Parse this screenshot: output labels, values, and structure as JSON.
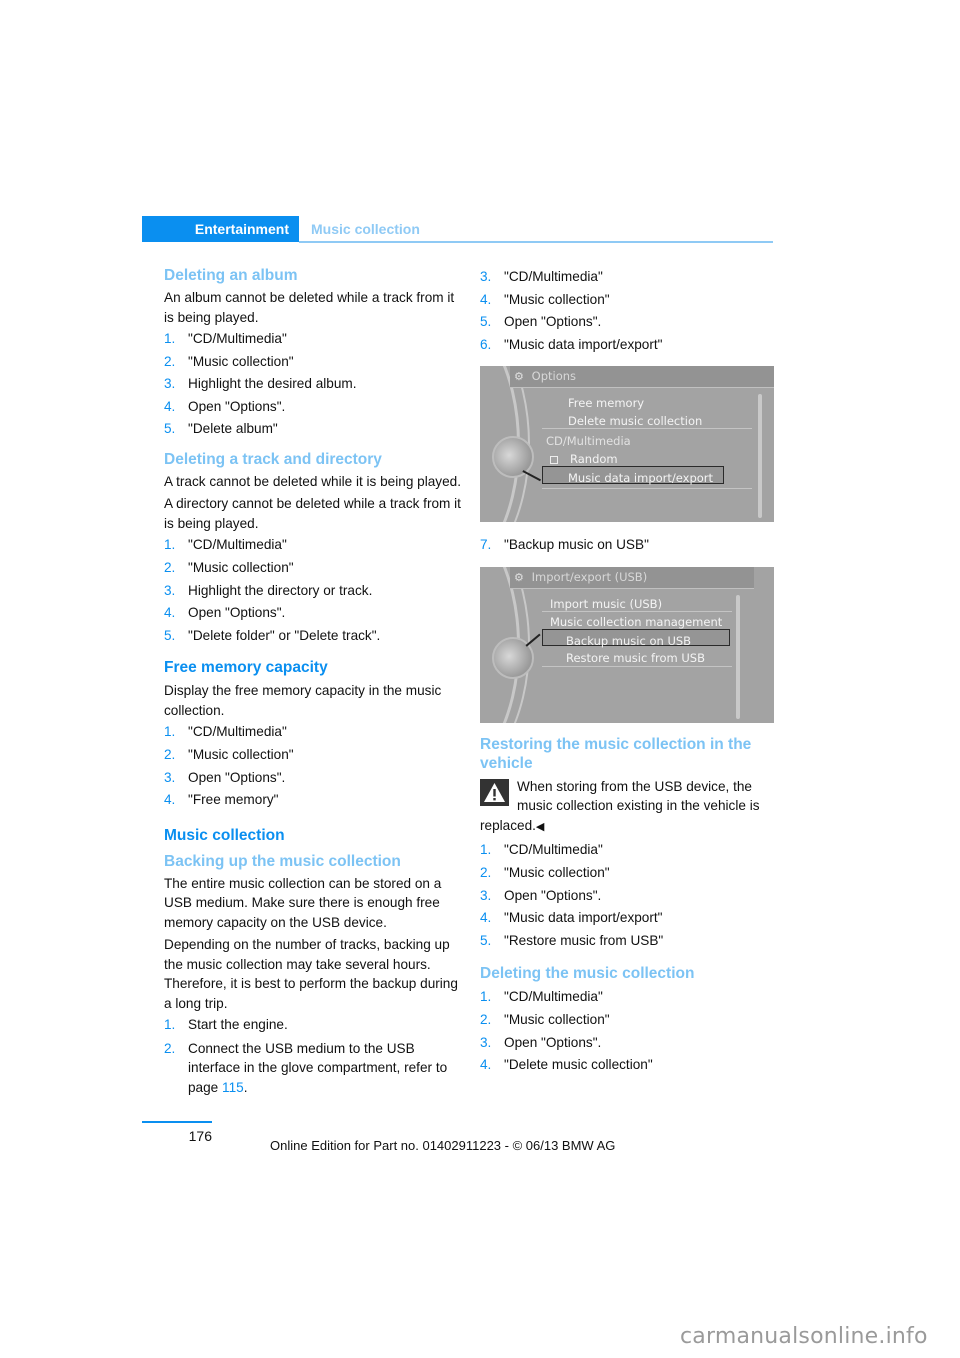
{
  "header": {
    "chapter": "Entertainment",
    "section": "Music collection"
  },
  "left_column": {
    "deleting_album": {
      "heading": "Deleting an album",
      "intro": "An album cannot be deleted while a track from it is being played.",
      "steps": [
        "\"CD/Multimedia\"",
        "\"Music collection\"",
        "Highlight the desired album.",
        "Open \"Options\".",
        "\"Delete album\""
      ]
    },
    "deleting_track": {
      "heading": "Deleting a track and directory",
      "intro1": "A track cannot be deleted while it is being played.",
      "intro2": "A directory cannot be deleted while a track from it is being played.",
      "steps": [
        "\"CD/Multimedia\"",
        "\"Music collection\"",
        "Highlight the directory or track.",
        "Open \"Options\".",
        "\"Delete folder\" or \"Delete track\"."
      ]
    },
    "free_memory": {
      "heading": "Free memory capacity",
      "intro": "Display the free memory capacity in the music collection.",
      "steps": [
        "\"CD/Multimedia\"",
        "\"Music collection\"",
        "Open \"Options\".",
        "\"Free memory\""
      ]
    },
    "music_collection": {
      "heading": "Music collection"
    },
    "backing_up": {
      "heading": "Backing up the music collection",
      "intro1": "The entire music collection can be stored on a USB medium. Make sure there is enough free memory capacity on the USB device.",
      "intro2": "Depending on the number of tracks, backing up the music collection may take several hours. Therefore, it is best to perform the backup during a long trip.",
      "step1": "Start the engine.",
      "step2_text": "Connect the USB medium to the USB interface in the glove compartment, refer to page ",
      "step2_link": "115",
      "step2_end": "."
    }
  },
  "right_column": {
    "continued_steps": [
      {
        "num": "3.",
        "text": "\"CD/Multimedia\""
      },
      {
        "num": "4.",
        "text": "\"Music collection\""
      },
      {
        "num": "5.",
        "text": "Open \"Options\"."
      },
      {
        "num": "6.",
        "text": "\"Music data import/export\""
      }
    ],
    "screen1": {
      "title": "Options",
      "items": [
        "Free memory",
        "Delete music collection"
      ],
      "group_label": "CD/Multimedia",
      "checkbox_item": "Random",
      "selected_item": "Music data import/export"
    },
    "step7": {
      "num": "7.",
      "text": "\"Backup music on USB\""
    },
    "screen2": {
      "title": "Import/export (USB)",
      "items": [
        "Import music (USB)",
        "Music collection management"
      ],
      "selected_item": "Backup music on USB",
      "after_item": "Restore music from USB"
    },
    "restoring": {
      "heading": "Restoring the music collection in the vehicle",
      "warning": "When storing from the USB device, the music collection existing in the vehicle is replaced.",
      "warning_end_mark": "◀",
      "steps": [
        "\"CD/Multimedia\"",
        "\"Music collection\"",
        "Open \"Options\".",
        "\"Music data import/export\"",
        "\"Restore music from USB\""
      ]
    },
    "deleting_collection": {
      "heading": "Deleting the music collection",
      "steps": [
        "\"CD/Multimedia\"",
        "\"Music collection\"",
        "Open \"Options\".",
        "\"Delete music collection\""
      ]
    }
  },
  "footer": {
    "page_number": "176",
    "edition": "Online Edition for Part no. 01402911223 - © 06/13 BMW AG",
    "watermark": "carmanualsonline.info"
  },
  "colors": {
    "accent": "#0a8ff0",
    "subheading": "#7cc3f4"
  }
}
